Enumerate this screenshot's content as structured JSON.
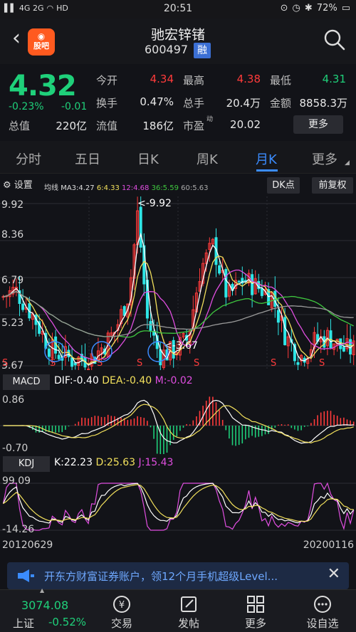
{
  "status": {
    "signal": "4G 2G",
    "hd": "HD",
    "time": "20:51",
    "battery": "72%"
  },
  "header": {
    "name": "驰宏锌锗",
    "code": "600497",
    "margin_tag": "融",
    "logo": "股吧"
  },
  "quote": {
    "price": "4.32",
    "change_pct": "-0.23%",
    "change": "-0.01",
    "open_label": "今开",
    "open": "4.34",
    "high_label": "最高",
    "high": "4.38",
    "low_label": "最低",
    "low": "4.31",
    "turnover_label": "换手",
    "turnover": "0.47%",
    "volume_label": "总手",
    "volume": "20.4万",
    "amount_label": "金额",
    "amount": "8858.3万",
    "mktcap_label": "总值",
    "mktcap": "220亿",
    "float_label": "流值",
    "float": "186亿",
    "pe_label": "市盈",
    "pe_sup": "动",
    "pe": "20.02",
    "more": "更多"
  },
  "tabs": [
    "分时",
    "五日",
    "日K",
    "周K",
    "月K",
    "更多"
  ],
  "active_tab": "月K",
  "toolbar": {
    "settings": "设置",
    "ma_label": "均线",
    "ma3": "MA3:4.27",
    "ma6": "6:4.33",
    "ma12": "12:4.68",
    "ma36": "36:5.59",
    "ma60": "60:5.63",
    "dk": "DK点",
    "adjust": "前复权"
  },
  "kline": {
    "y_labels": [
      "9.92",
      "8.36",
      "6.79",
      "5.23",
      "3.67"
    ],
    "max_label": "<-9.92",
    "min_label": "<-3.67",
    "signal": "S"
  },
  "macd": {
    "label": "MACD",
    "dif": "DIF:-0.40",
    "dea": "DEA:-0.40",
    "m": "M:-0.02",
    "top": "0.86",
    "bottom": "-0.70"
  },
  "kdj": {
    "label": "KDJ",
    "k": "K:22.23",
    "d": "D:25.63",
    "j": "J:15.43",
    "top": "99.09",
    "bottom": "-14.26"
  },
  "dates": {
    "start": "20120629",
    "end": "20200116"
  },
  "banner": {
    "text": "开东方财富证券账户，领12个月手机超级Level..."
  },
  "bottom": {
    "index_value": "3074.08",
    "index_name": "上证",
    "index_change": "-0.52%",
    "items": [
      "交易",
      "发帖",
      "更多",
      "设自选"
    ]
  },
  "colors": {
    "up": "#ff3b3b",
    "down": "#1fd07a",
    "accent": "#3b8cff"
  }
}
